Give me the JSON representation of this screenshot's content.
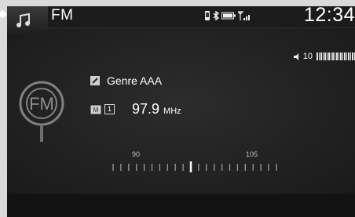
{
  "header": {
    "source_label": "FM",
    "clock": "12:34",
    "status_icons": [
      "phone-icon",
      "bluetooth-icon",
      "battery-icon",
      "signal-icon"
    ]
  },
  "volume": {
    "label": "10",
    "level_fraction": 0.5
  },
  "station": {
    "genre": "Genre AAA",
    "preset_number": "1",
    "frequency": "97.9",
    "unit": "MHz"
  },
  "tuner": {
    "scale_labels": [
      "90",
      "105"
    ],
    "tick_count": 22,
    "current_tick_index": 10
  },
  "colors": {
    "background": "#1b1b1b",
    "text": "#ffffff",
    "frame": "#dadada"
  }
}
